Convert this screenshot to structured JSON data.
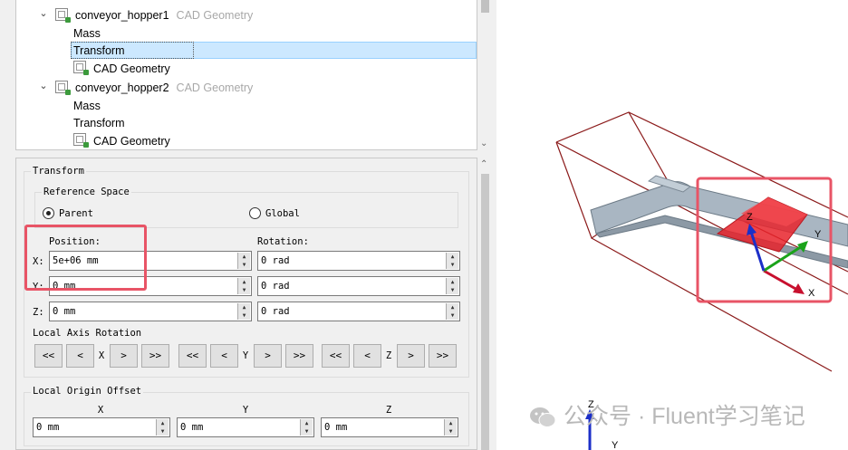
{
  "tree": {
    "items": [
      {
        "label": "conveyor_hopper1",
        "type": "CAD Geometry"
      },
      {
        "label": "Mass"
      },
      {
        "label": "Transform"
      },
      {
        "label": "CAD Geometry"
      },
      {
        "label": "conveyor_hopper2",
        "type": "CAD Geometry"
      },
      {
        "label": "Mass"
      },
      {
        "label": "Transform"
      },
      {
        "label": "CAD Geometry"
      }
    ],
    "selected": "Transform"
  },
  "transform": {
    "title": "Transform",
    "reference_space": {
      "title": "Reference Space",
      "options": [
        "Parent",
        "Global"
      ],
      "selected": "Parent"
    },
    "position": {
      "label": "Position:",
      "x_label": "X:",
      "y_label": "Y:",
      "z_label": "Z:",
      "x": "5e+06 mm",
      "y": "0 mm",
      "z": "0 mm"
    },
    "rotation": {
      "label": "Rotation:",
      "x": "0 rad",
      "y": "0 rad",
      "z": "0 rad"
    },
    "local_axis_rotation": {
      "title": "Local Axis Rotation",
      "buttons": [
        "<<",
        "<",
        ">",
        ">>"
      ],
      "axes": [
        "X",
        "Y",
        "Z"
      ]
    }
  },
  "local_origin_offset": {
    "title": "Local Origin Offset",
    "axes": [
      "X",
      "Y",
      "Z"
    ],
    "values": [
      "0 mm",
      "0 mm",
      "0 mm"
    ]
  },
  "viewport": {
    "triad_labels": {
      "x": "X",
      "y": "Y",
      "z": "Z"
    },
    "secondary_triad_labels": {
      "z": "Z",
      "y": "Y"
    },
    "colors": {
      "wire": "#8b1a1a",
      "part": "#a9b6c2",
      "part_edge": "#6c7a86",
      "highlight": "#e8232b",
      "x_axis": "#c8102e",
      "y_axis": "#1aa31a",
      "z_axis": "#1c2fc8",
      "annotation": "#e85466"
    }
  },
  "watermark": {
    "text": "公众号 · Fluent学习笔记"
  }
}
